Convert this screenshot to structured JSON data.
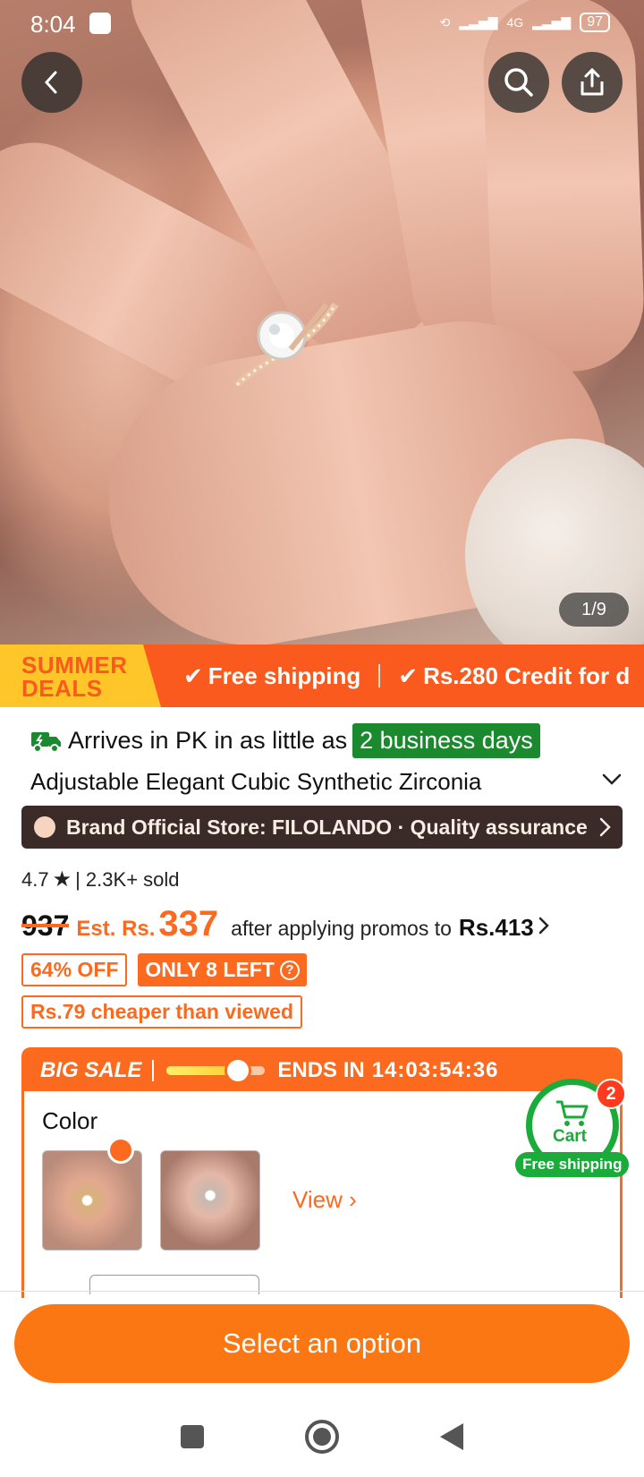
{
  "status_bar": {
    "time": "8:04",
    "battery": "97",
    "network": "4G"
  },
  "gallery": {
    "counter": "1/9"
  },
  "promo_banner": {
    "badge_line1": "SUMMER",
    "badge_line2": "DEALS",
    "items": [
      "Free shipping",
      "Rs.280 Credit for d"
    ]
  },
  "delivery": {
    "prefix": "Arrives in PK in as little as",
    "highlight": "2 business days"
  },
  "product": {
    "title": "Adjustable Elegant Cubic Synthetic Zirconia",
    "store": "Brand Official Store: FILOLANDO · Quality assurance",
    "rating": "4.7",
    "sold": "| 2.3K+ sold",
    "old_price": "937",
    "est_label": "Est. Rs.",
    "est_price": "337",
    "after_promo": "after applying promos to",
    "promo_price": "Rs.413",
    "discount": "64% OFF",
    "stock": "ONLY 8 LEFT",
    "cheaper": "Rs.79 cheaper than viewed"
  },
  "sale": {
    "label": "BIG SALE",
    "ends_label": "ENDS IN",
    "countdown": "14:03:54:36",
    "progress": 0.72,
    "color_label": "Color",
    "view_label": "View"
  },
  "cart": {
    "label": "Cart",
    "count": "2",
    "shipping": "Free shipping"
  },
  "cta": {
    "label": "Select an option"
  },
  "colors": {
    "accent": "#fb6a1e",
    "green": "#1b8a2f",
    "store_bg": "#3a2a28"
  }
}
